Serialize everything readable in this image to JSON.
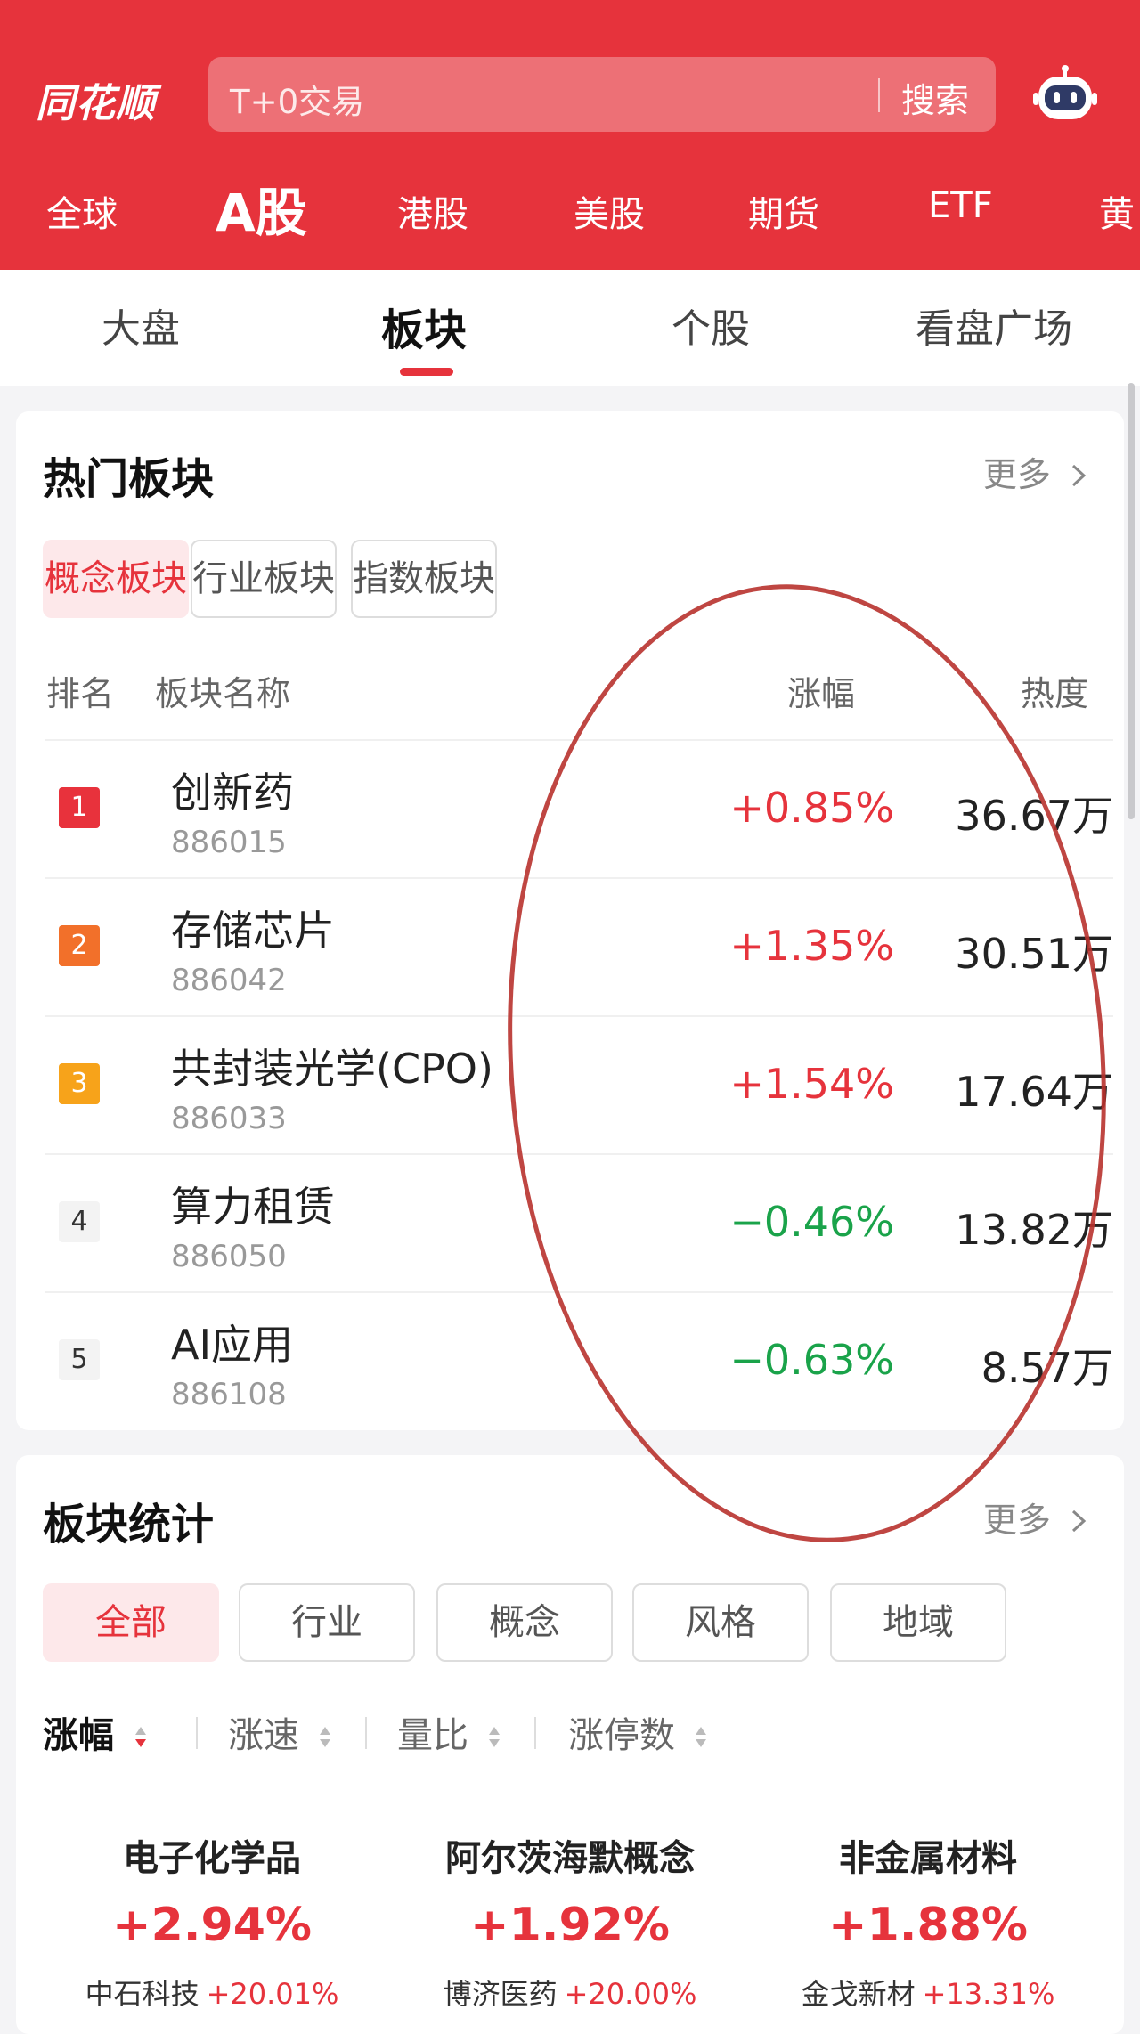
{
  "header": {
    "logo": "同花顺",
    "search_placeholder": "T+0交易",
    "search_button": "搜索",
    "market_tabs": [
      "全球",
      "A股",
      "港股",
      "美股",
      "期货",
      "ETF",
      "黄"
    ]
  },
  "subtabs": [
    "大盘",
    "板块",
    "个股",
    "看盘广场"
  ],
  "hot_sectors": {
    "title": "热门板块",
    "more": "更多",
    "filters": [
      "概念板块",
      "行业板块",
      "指数板块"
    ],
    "columns": {
      "rank": "排名",
      "name": "板块名称",
      "change": "涨幅",
      "heat": "热度"
    },
    "rows": [
      {
        "rank": "1",
        "name": "创新药",
        "code": "886015",
        "change": "+0.85%",
        "heat": "36.67万"
      },
      {
        "rank": "2",
        "name": "存储芯片",
        "code": "886042",
        "change": "+1.35%",
        "heat": "30.51万"
      },
      {
        "rank": "3",
        "name": "共封装光学(CPO)",
        "code": "886033",
        "change": "+1.54%",
        "heat": "17.64万"
      },
      {
        "rank": "4",
        "name": "算力租赁",
        "code": "886050",
        "change": "−0.46%",
        "heat": "13.82万"
      },
      {
        "rank": "5",
        "name": "AI应用",
        "code": "886108",
        "change": "−0.63%",
        "heat": "8.57万"
      }
    ]
  },
  "sector_stats": {
    "title": "板块统计",
    "more": "更多",
    "filters": [
      "全部",
      "行业",
      "概念",
      "风格",
      "地域"
    ],
    "sort": [
      "涨幅",
      "涨速",
      "量比",
      "涨停数"
    ],
    "items": [
      {
        "name": "电子化学品",
        "change": "+2.94%",
        "leader": "中石科技",
        "leader_change": "+20.01%"
      },
      {
        "name": "阿尔茨海默概念",
        "change": "+1.92%",
        "leader": "博济医药",
        "leader_change": "+20.00%"
      },
      {
        "name": "非金属材料",
        "change": "+1.88%",
        "leader": "金戈新材",
        "leader_change": "+13.31%"
      }
    ]
  },
  "colors": {
    "brand_red": "#e6333c",
    "up": "#e6333c",
    "down": "#1aa34a",
    "annotation": "#b8322e"
  }
}
